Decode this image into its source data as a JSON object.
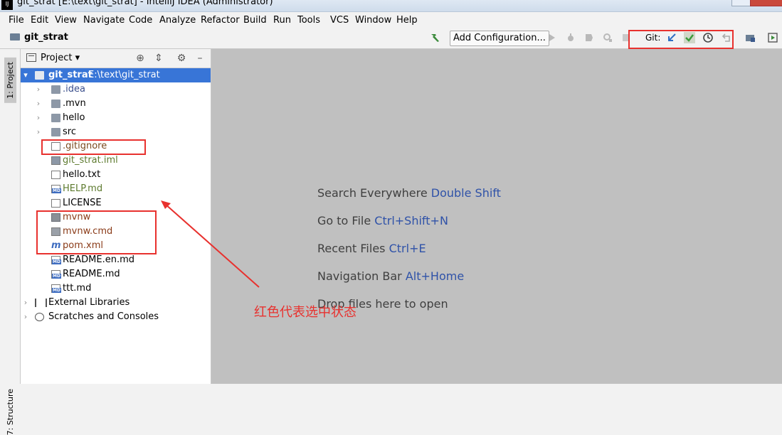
{
  "window": {
    "title": "git_strat [E:\\text\\git_strat] - IntelliJ IDEA (Administrator)",
    "app_icon": "IJ"
  },
  "menu": [
    {
      "label": "File"
    },
    {
      "label": "Edit"
    },
    {
      "label": "View"
    },
    {
      "label": "Navigate"
    },
    {
      "label": "Code"
    },
    {
      "label": "Analyze"
    },
    {
      "label": "Refactor"
    },
    {
      "label": "Build"
    },
    {
      "label": "Run"
    },
    {
      "label": "Tools"
    },
    {
      "label": "VCS"
    },
    {
      "label": "Window"
    },
    {
      "label": "Help"
    }
  ],
  "navbar": {
    "project_name": "git_strat",
    "add_configuration": "Add Configuration...",
    "git_label": "Git:"
  },
  "sidebar": {
    "project_tab": "1: Project",
    "structure_tab": "7: Structure"
  },
  "project_panel": {
    "title": "Project",
    "root": {
      "name": "git_strat",
      "path": "E:\\text\\git_strat"
    },
    "items": [
      {
        "name": ".idea",
        "type": "folder",
        "color": "#3b4f8c"
      },
      {
        "name": ".mvn",
        "type": "folder",
        "color": "#000000"
      },
      {
        "name": "hello",
        "type": "folder",
        "color": "#000000"
      },
      {
        "name": "src",
        "type": "folder",
        "color": "#000000"
      },
      {
        "name": ".gitignore",
        "type": "file-ignore",
        "color": "#7a4a1e"
      },
      {
        "name": "git_strat.iml",
        "type": "file-iml",
        "color": "#5d7a2e"
      },
      {
        "name": "hello.txt",
        "type": "file-txt",
        "color": "#000000"
      },
      {
        "name": "HELP.md",
        "type": "file-md",
        "color": "#5d7a2e"
      },
      {
        "name": "LICENSE",
        "type": "file-txt",
        "color": "#000000"
      },
      {
        "name": "mvnw",
        "type": "file-sh",
        "color": "#8a3b18"
      },
      {
        "name": "mvnw.cmd",
        "type": "file-cmd",
        "color": "#8a3b18"
      },
      {
        "name": "pom.xml",
        "type": "file-maven",
        "color": "#8a3b18"
      },
      {
        "name": "README.en.md",
        "type": "file-md",
        "color": "#000000"
      },
      {
        "name": "README.md",
        "type": "file-md",
        "color": "#000000"
      },
      {
        "name": "ttt.md",
        "type": "file-md",
        "color": "#000000"
      }
    ],
    "external_libraries": "External Libraries",
    "scratches": "Scratches and Consoles"
  },
  "editor_hints": [
    {
      "text": "Search Everywhere",
      "key": "Double Shift"
    },
    {
      "text": "Go to File",
      "key": "Ctrl+Shift+N"
    },
    {
      "text": "Recent Files",
      "key": "Ctrl+E"
    },
    {
      "text": "Navigation Bar",
      "key": "Alt+Home"
    },
    {
      "text": "Drop files here to open",
      "key": ""
    }
  ],
  "annotation": {
    "text": "红色代表选中状态",
    "color": "#e8312e"
  }
}
